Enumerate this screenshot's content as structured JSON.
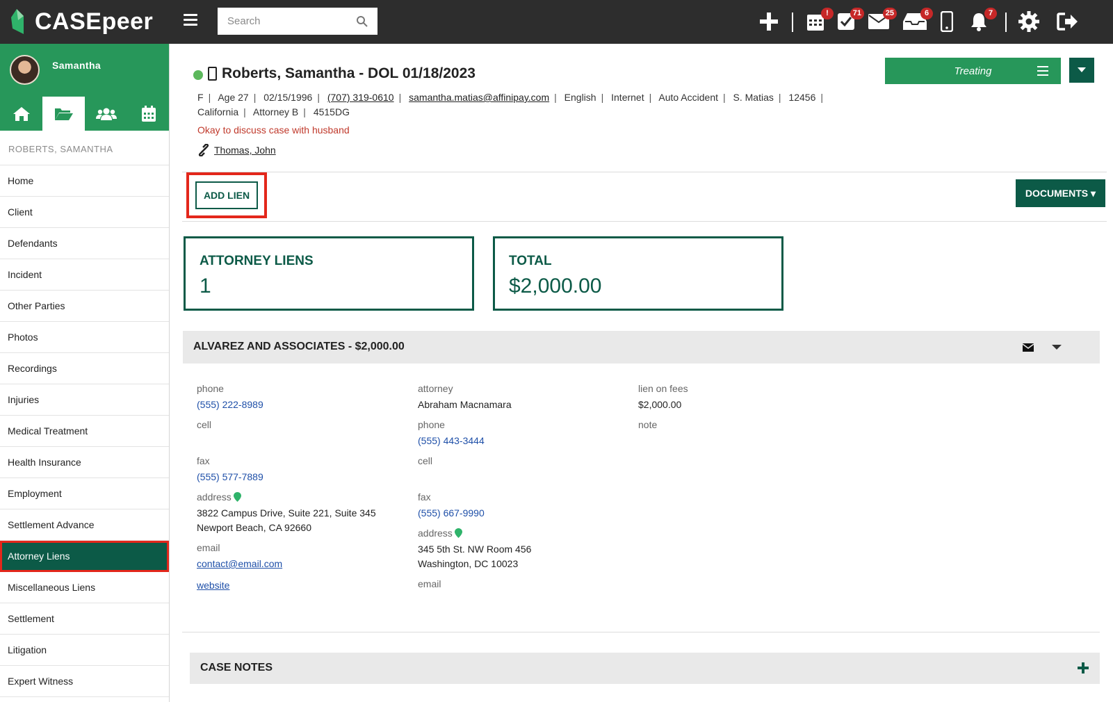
{
  "app": {
    "logo_text": "CASEpeer"
  },
  "search": {
    "placeholder": "Search"
  },
  "topbar": {
    "badges": {
      "calendar": "!",
      "tasks": "71",
      "messages": "25",
      "inbox": "6",
      "notifications": "7"
    }
  },
  "sidebar": {
    "user_name": "Samantha",
    "case_name": "ROBERTS, SAMANTHA",
    "items": [
      "Home",
      "Client",
      "Defendants",
      "Incident",
      "Other Parties",
      "Photos",
      "Recordings",
      "Injuries",
      "Medical Treatment",
      "Health Insurance",
      "Employment",
      "Settlement Advance",
      "Attorney Liens",
      "Miscellaneous Liens",
      "Settlement",
      "Litigation",
      "Expert Witness"
    ],
    "active_item": "Attorney Liens"
  },
  "header": {
    "title": "Roberts, Samantha - DOL 01/18/2023",
    "meta": {
      "sex": "F",
      "age": "Age 27",
      "dob": "02/15/1996",
      "phone": "(707) 319-0610",
      "email": "samantha.matias@affinipay.com",
      "language": "English",
      "source": "Internet",
      "case_type": "Auto Accident",
      "staff": "S. Matias",
      "number": "12456",
      "state": "California",
      "attorney": "Attorney B",
      "code": "4515DG"
    },
    "note": "Okay to discuss case with husband",
    "related_contact": "Thomas, John",
    "status": "Treating"
  },
  "actions": {
    "add_lien": "ADD LIEN",
    "documents": "DOCUMENTS ▾"
  },
  "stats": {
    "liens_label": "ATTORNEY LIENS",
    "liens_value": "1",
    "total_label": "TOTAL",
    "total_value": "$2,000.00"
  },
  "lien": {
    "title": "ALVAREZ AND ASSOCIATES - $2,000.00",
    "firm": {
      "phone_label": "phone",
      "phone": "(555) 222-8989",
      "cell_label": "cell",
      "fax_label": "fax",
      "fax": "(555) 577-7889",
      "address_label": "address",
      "address_line1": "3822 Campus Drive, Suite 221, Suite 345",
      "address_line2": "Newport Beach, CA 92660",
      "email_label": "email",
      "email": "contact@email.com ",
      "website": "website "
    },
    "attorney": {
      "attorney_label": "attorney",
      "attorney": "Abraham Macnamara",
      "phone_label": "phone",
      "phone": "(555) 443-3444",
      "cell_label": "cell",
      "fax_label": "fax",
      "fax": "(555) 667-9990",
      "address_label": "address",
      "address_line1": "345 5th St. NW Room 456",
      "address_line2": "Washington, DC 10023",
      "email_label": "email"
    },
    "fees": {
      "lien_on_fees_label": "lien on fees",
      "lien_on_fees": "$2,000.00",
      "note_label": "note"
    }
  },
  "case_notes": {
    "title": "CASE NOTES"
  },
  "colors": {
    "brand_green": "#27975a",
    "dark_teal": "#0c5a47",
    "highlight_red": "#e3271b",
    "topbar": "#2d2d2d"
  }
}
